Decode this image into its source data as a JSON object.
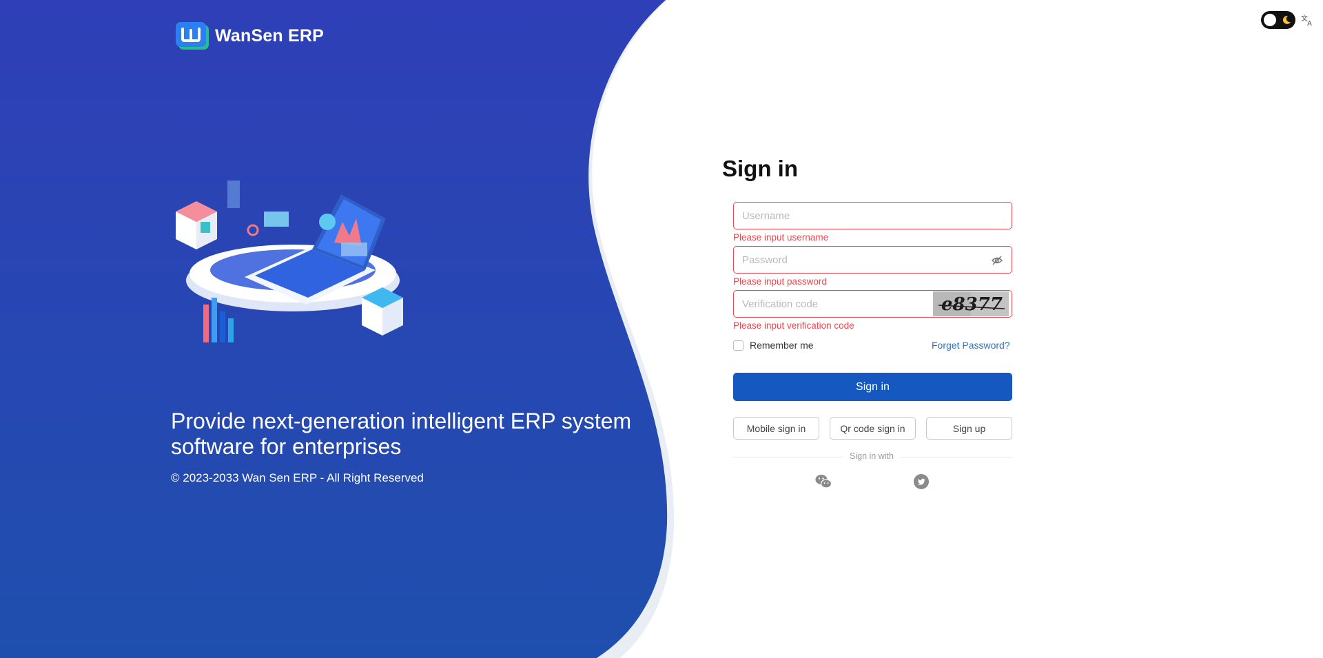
{
  "brand": {
    "name": "WanSen ERP",
    "logo_letter": "W"
  },
  "hero": {
    "tagline": "Provide next-generation intelligent ERP system software for enterprises",
    "copyright": "© 2023-2033 Wan Sen ERP - All Right Reserved"
  },
  "top_controls": {
    "theme_icon": "moon-icon",
    "language_icon": "translate-icon"
  },
  "signin": {
    "title": "Sign in",
    "username": {
      "placeholder": "Username",
      "value": "",
      "error": "Please input username"
    },
    "password": {
      "placeholder": "Password",
      "value": "",
      "error": "Please input password"
    },
    "verification": {
      "placeholder": "Verification code",
      "value": "",
      "error": "Please input verification code",
      "captcha_text": "e8377"
    },
    "remember_label": "Remember me",
    "forgot_label": "Forget Password?",
    "submit_label": "Sign in",
    "alt_buttons": {
      "mobile": "Mobile sign in",
      "qr": "Qr code sign in",
      "signup": "Sign up"
    },
    "social_divider": "Sign in with",
    "social_icons": [
      "wechat-icon",
      "twitter-icon"
    ]
  },
  "colors": {
    "hero_blue": "#2f45b6",
    "primary_button": "#1458c0",
    "error": "#f0464f",
    "link": "#2a72c9"
  }
}
